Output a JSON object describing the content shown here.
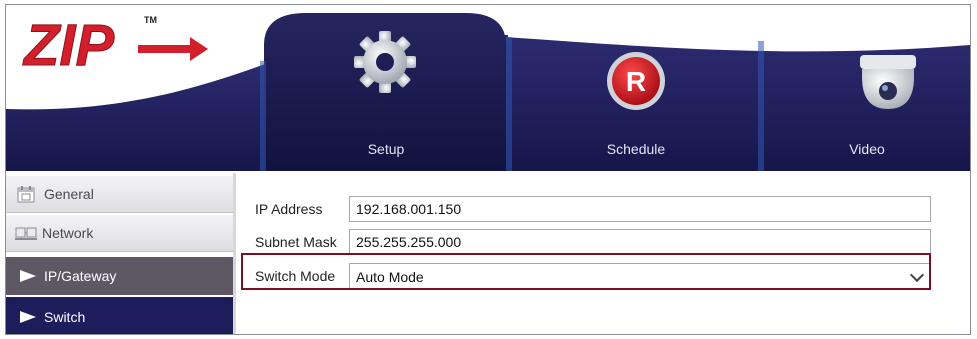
{
  "brand": {
    "logo_text": "ZIP",
    "trademark": "TM",
    "colors": {
      "navy": "#1e1d5c",
      "red": "#d21f2b"
    }
  },
  "nav": {
    "items": [
      {
        "label": "Setup",
        "icon": "gear-icon",
        "active": true
      },
      {
        "label": "Schedule",
        "icon": "record-r-icon",
        "active": false
      },
      {
        "label": "Video",
        "icon": "dome-camera-icon",
        "active": false
      }
    ]
  },
  "sidebar": {
    "items": [
      {
        "label": "General",
        "icon": "calendar-icon"
      },
      {
        "label": "Network",
        "icon": "network-devices-icon"
      },
      {
        "label": "IP/Gateway",
        "icon": "arrow-icon"
      },
      {
        "label": "Switch",
        "icon": "arrow-icon"
      }
    ]
  },
  "form": {
    "ip_address": {
      "label": "IP Address",
      "value": "192.168.001.150"
    },
    "subnet_mask": {
      "label": "Subnet Mask",
      "value": "255.255.255.000"
    },
    "switch_mode": {
      "label": "Switch Mode",
      "value": "Auto Mode"
    }
  }
}
